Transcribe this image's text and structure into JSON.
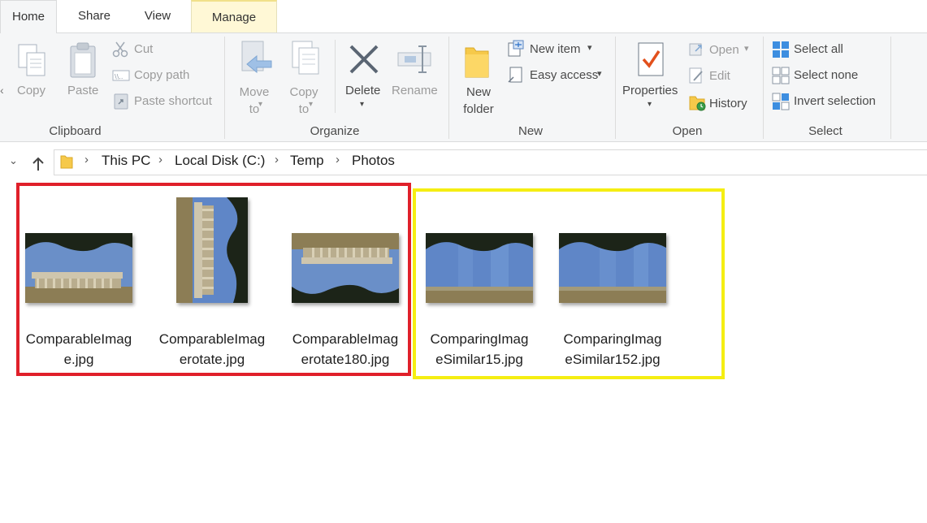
{
  "tabs": [
    "Home",
    "Share",
    "View",
    "Manage"
  ],
  "clipboard": {
    "copy": "Copy",
    "paste": "Paste",
    "cut": "Cut",
    "copy_path": "Copy path",
    "paste_shortcut": "Paste shortcut",
    "group": "Clipboard"
  },
  "organize": {
    "move_to": "Move\nto",
    "copy_to": "Copy\nto",
    "delete": "Delete",
    "rename": "Rename",
    "group": "Organize"
  },
  "new": {
    "new_folder": "New\nfolder",
    "new_item": "New item",
    "easy_access": "Easy access",
    "group": "New"
  },
  "open": {
    "properties": "Properties",
    "open": "Open",
    "edit": "Edit",
    "history": "History",
    "group": "Open"
  },
  "select": {
    "select_all": "Select all",
    "select_none": "Select none",
    "invert_selection": "Invert selection",
    "group": "Select"
  },
  "breadcrumb": [
    "This PC",
    "Local Disk (C:)",
    "Temp",
    "Photos"
  ],
  "files": [
    {
      "name": "ComparableImag\ne.jpg"
    },
    {
      "name": "ComparableImag\nerotate.jpg"
    },
    {
      "name": "ComparableImag\nerotate180.jpg"
    },
    {
      "name": "ComparingImag\neSimilar15.jpg"
    },
    {
      "name": "ComparingImag\neSimilar152.jpg"
    }
  ],
  "colors": {
    "highlight_left": "#e0202a",
    "highlight_right": "#f5ee12",
    "sky": "#5f86c7",
    "accent": "#2a6fc9"
  }
}
